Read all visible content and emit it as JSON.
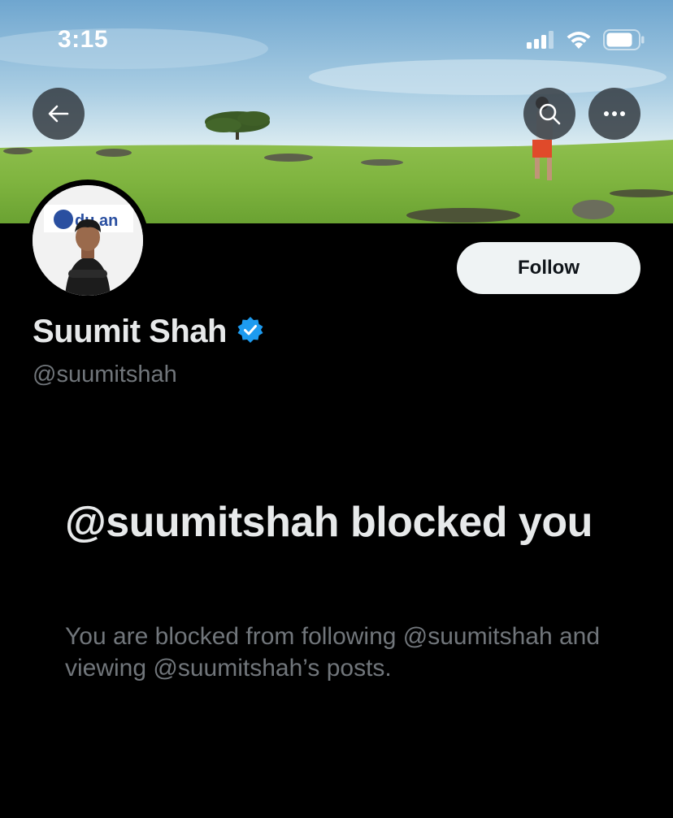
{
  "status_bar": {
    "time": "3:15",
    "icons": [
      "signal-icon",
      "wifi-icon",
      "battery-icon"
    ]
  },
  "header": {
    "back_icon": "arrow-left-icon",
    "search_icon": "search-icon",
    "more_icon": "more-horizontal-icon"
  },
  "profile": {
    "display_name": "Suumit Shah",
    "handle": "@suumitshah",
    "verified": true,
    "verified_color": "#1d9bf0",
    "avatar_logo_text": "du  an",
    "follow_label": "Follow"
  },
  "blocked": {
    "title": "@suumitshah blocked you",
    "description": "You are blocked from following @suumitshah and viewing @suumitshah’s posts."
  },
  "colors": {
    "background": "#000000",
    "primary_text": "#e7e9ea",
    "secondary_text": "#71767b",
    "follow_button_bg": "#eff3f4"
  }
}
